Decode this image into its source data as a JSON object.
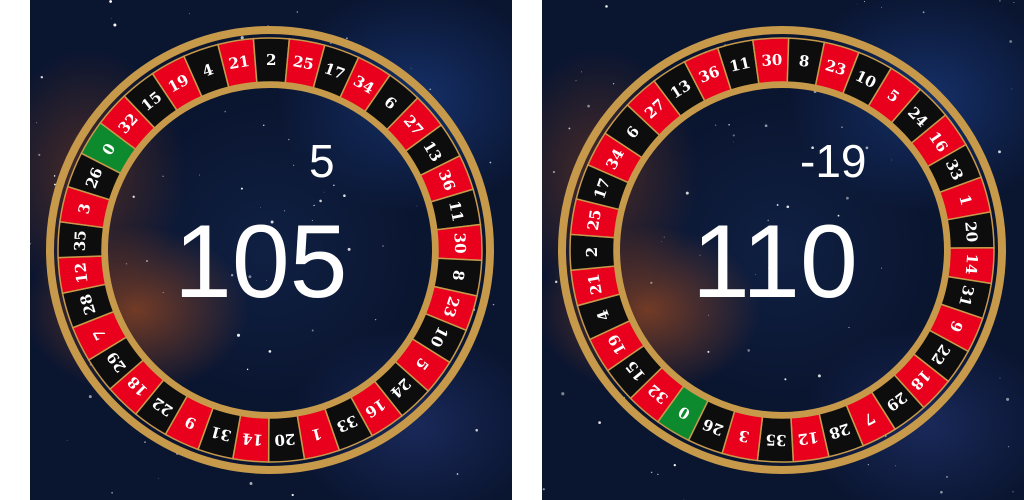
{
  "colors": {
    "red": "#e8001c",
    "black": "#0d0d0d",
    "green": "#0e8a2e",
    "rim": "#c79a4b",
    "text": "#ffffff"
  },
  "panels": [
    {
      "delta": "5",
      "balance": "105",
      "pockets": [
        "0",
        "32",
        "15",
        "19",
        "4",
        "21",
        "2",
        "25",
        "17",
        "34",
        "6",
        "27",
        "13",
        "36",
        "11",
        "30",
        "8",
        "23",
        "10",
        "5",
        "24",
        "16",
        "33",
        "1",
        "20",
        "14",
        "31",
        "9",
        "22",
        "18",
        "29",
        "7",
        "28",
        "12",
        "35",
        "3",
        "26"
      ],
      "start_angle_deg": 302
    },
    {
      "delta": "-19",
      "balance": "110",
      "pockets": [
        "0",
        "32",
        "15",
        "19",
        "4",
        "21",
        "2",
        "25",
        "17",
        "34",
        "6",
        "27",
        "13",
        "36",
        "11",
        "30",
        "8",
        "23",
        "10",
        "5",
        "24",
        "16",
        "33",
        "1",
        "20",
        "14",
        "31",
        "9",
        "22",
        "18",
        "29",
        "7",
        "28",
        "12",
        "35",
        "3",
        "26"
      ],
      "start_angle_deg": 211
    }
  ]
}
